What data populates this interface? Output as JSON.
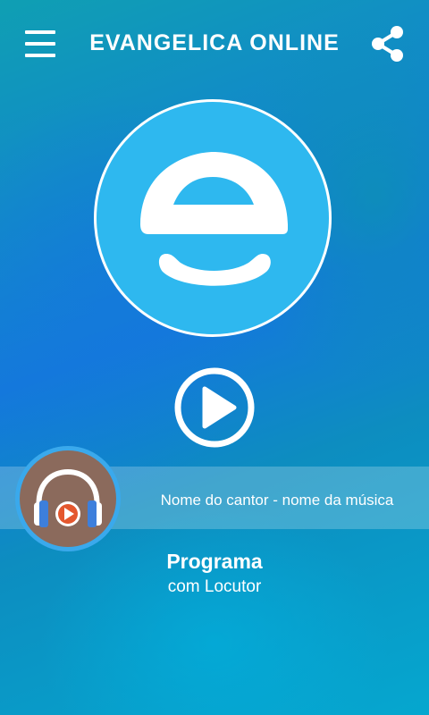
{
  "header": {
    "title": "EVANGELICA ONLINE",
    "menu_icon": "hamburger-menu-icon",
    "share_icon": "share-icon"
  },
  "logo": {
    "icon": "e-smile-logo-icon",
    "color": "#2eb8ef"
  },
  "player": {
    "play_icon": "play-icon",
    "now_playing": "Nome do cantor - nome da música",
    "album_icon": "headphones-play-icon",
    "program_title": "Programa",
    "program_subtitle": "com Locutor"
  },
  "colors": {
    "accent": "#2eb8ef",
    "album_bg": "#8b6a5c",
    "play_red": "#e4572e"
  }
}
